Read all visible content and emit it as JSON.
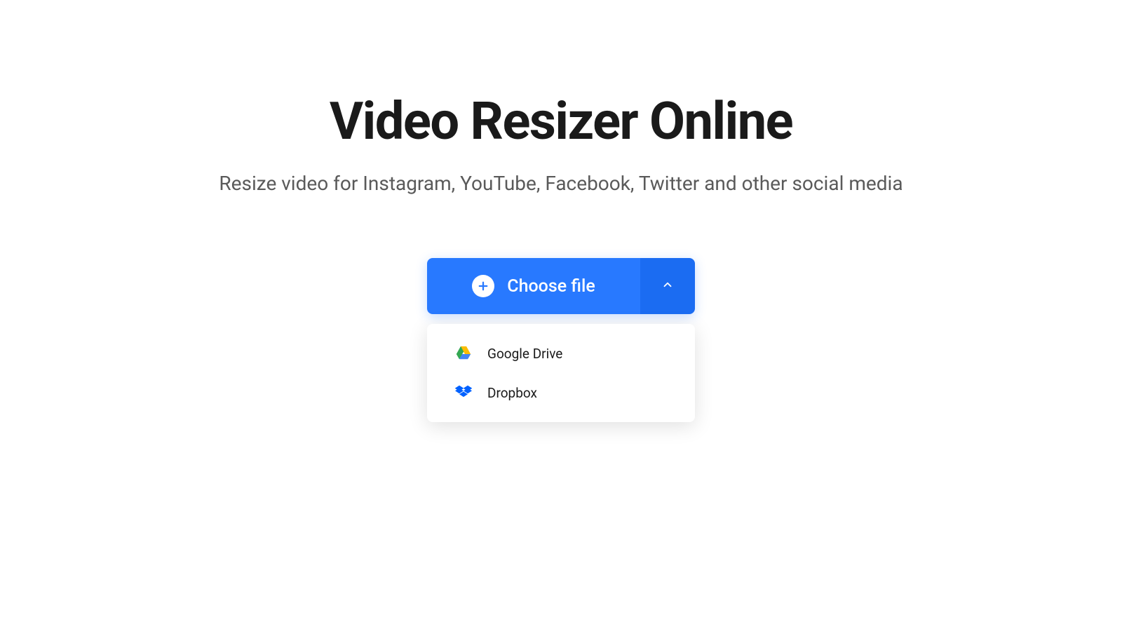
{
  "header": {
    "title": "Video Resizer Online",
    "subtitle": "Resize video for Instagram, YouTube, Facebook, Twitter and other social media"
  },
  "upload": {
    "choose_label": "Choose file",
    "sources": [
      {
        "label": "Google Drive",
        "icon": "google-drive-icon"
      },
      {
        "label": "Dropbox",
        "icon": "dropbox-icon"
      }
    ]
  }
}
